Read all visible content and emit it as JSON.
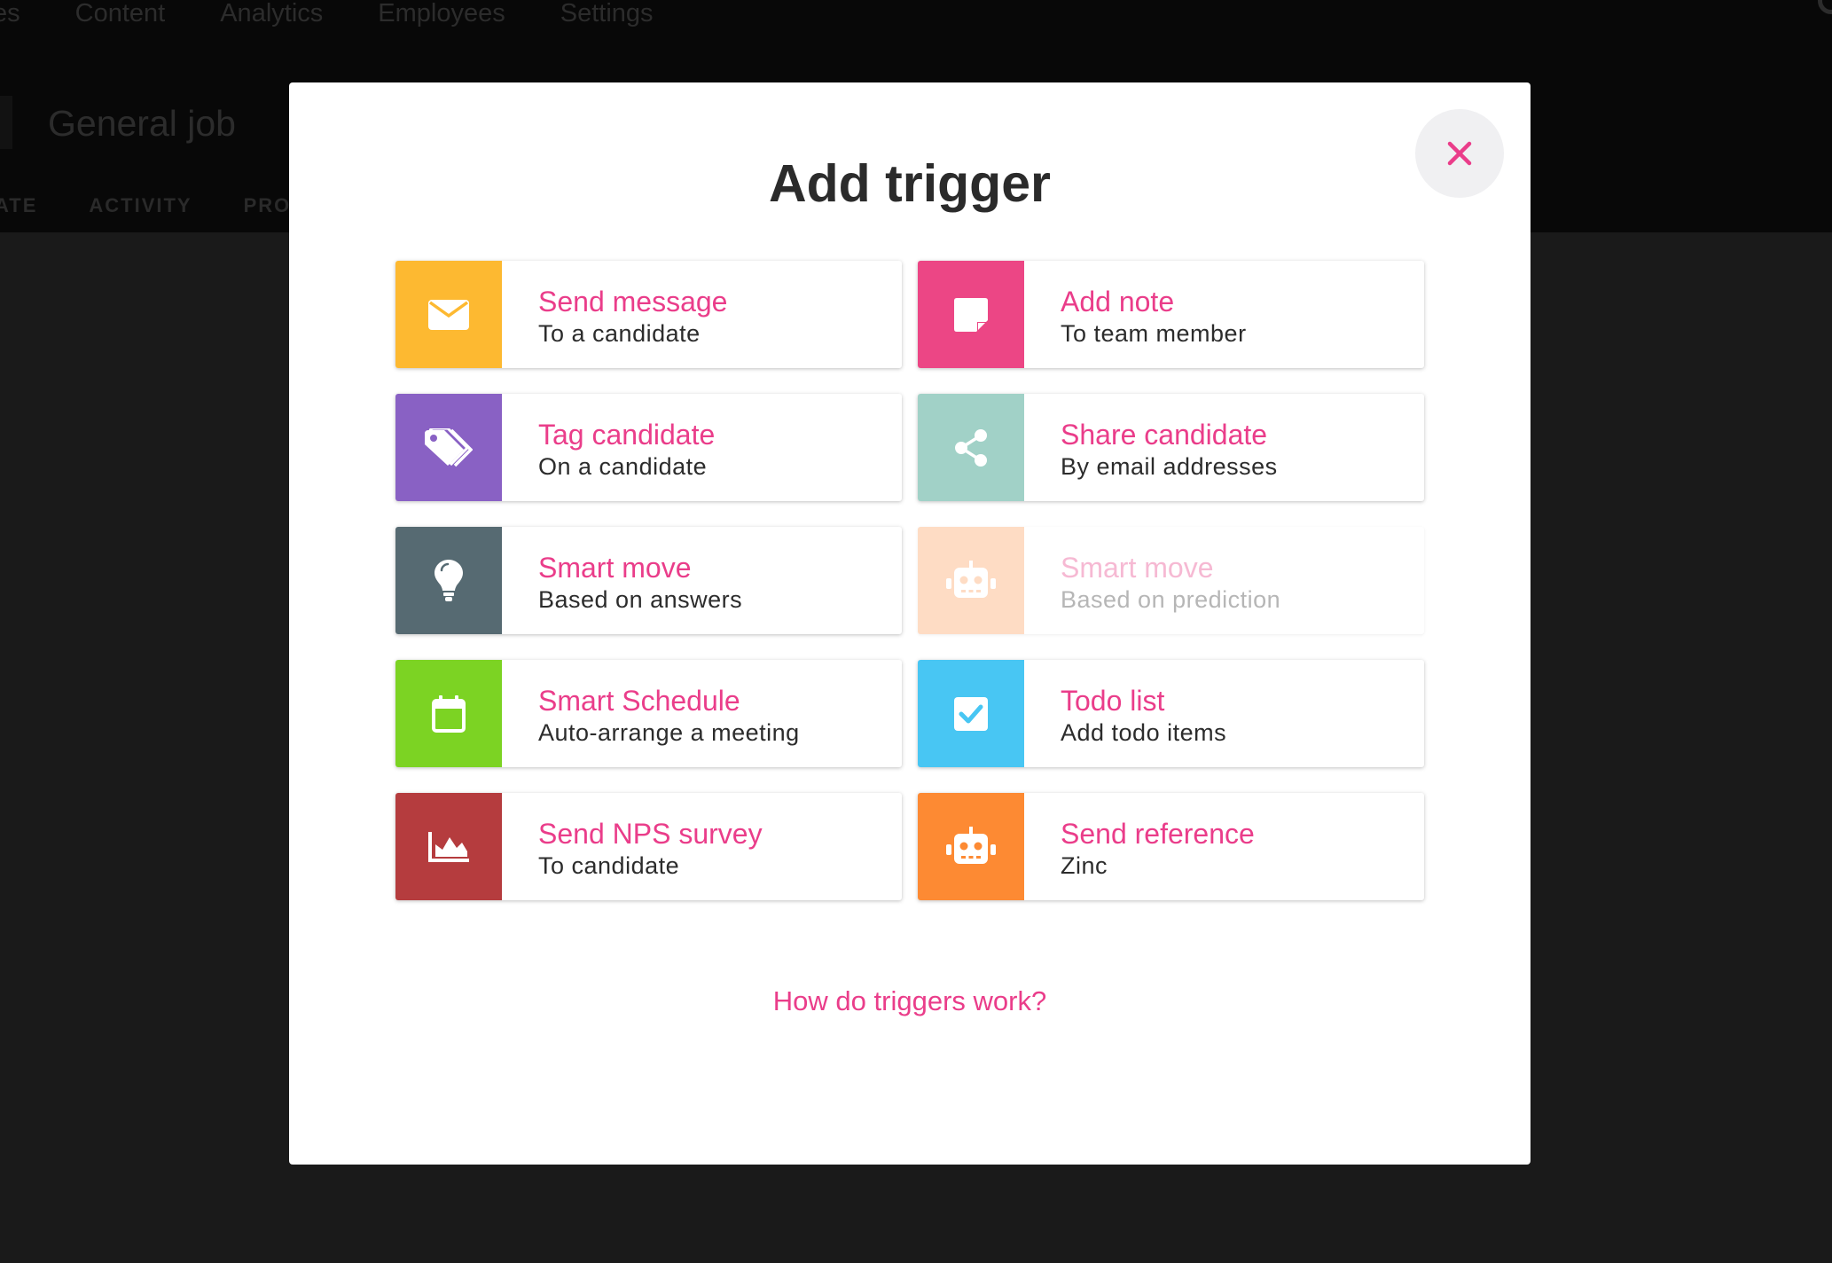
{
  "background": {
    "nav_items": [
      "es",
      "Content",
      "Analytics",
      "Employees",
      "Settings"
    ],
    "job_title": "General job",
    "subtabs": [
      "ATE",
      "ACTIVITY",
      "PRO"
    ]
  },
  "modal": {
    "title": "Add trigger",
    "close_icon": "close-icon",
    "help_link": "How do triggers work?"
  },
  "accent_color": "#ea3d8a",
  "triggers": [
    {
      "title": "Send message",
      "subtitle": "To a candidate",
      "icon": "envelope-icon",
      "color": "#fdb931",
      "enabled": true
    },
    {
      "title": "Add note",
      "subtitle": "To team member",
      "icon": "note-icon",
      "color": "#ec4685",
      "enabled": true
    },
    {
      "title": "Tag candidate",
      "subtitle": "On a candidate",
      "icon": "tags-icon",
      "color": "#8961c4",
      "enabled": true
    },
    {
      "title": "Share candidate",
      "subtitle": "By email addresses",
      "icon": "share-icon",
      "color": "#a1d1c7",
      "enabled": true
    },
    {
      "title": "Smart move",
      "subtitle": "Based on answers",
      "icon": "lightbulb-icon",
      "color": "#566a72",
      "enabled": true
    },
    {
      "title": "Smart move",
      "subtitle": "Based on prediction",
      "icon": "robot-icon",
      "color": "#fedcc4",
      "enabled": false
    },
    {
      "title": "Smart Schedule",
      "subtitle": "Auto-arrange a meeting",
      "icon": "calendar-icon",
      "color": "#7cd323",
      "enabled": true
    },
    {
      "title": "Todo list",
      "subtitle": "Add todo items",
      "icon": "checkbox-icon",
      "color": "#48c6f3",
      "enabled": true
    },
    {
      "title": "Send NPS survey",
      "subtitle": "To candidate",
      "icon": "area-chart-icon",
      "color": "#b53c3e",
      "enabled": true
    },
    {
      "title": "Send reference",
      "subtitle": "Zinc",
      "icon": "robot-icon",
      "color": "#fd8a33",
      "enabled": true
    }
  ]
}
